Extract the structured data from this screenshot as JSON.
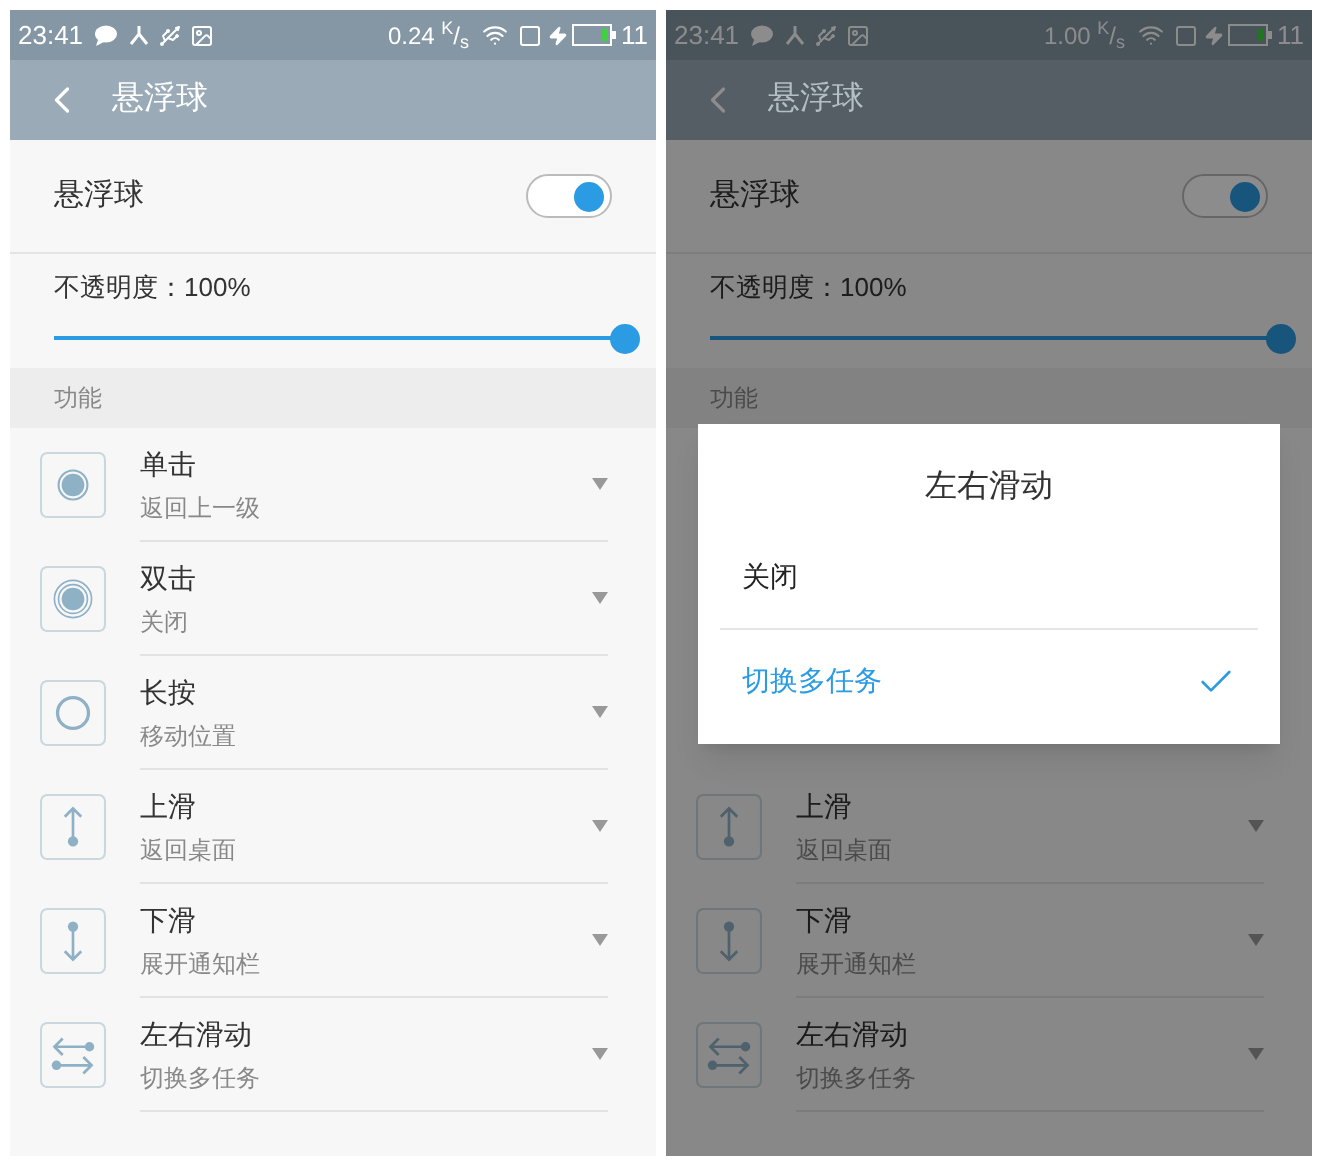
{
  "phones": [
    {
      "status_bar": {
        "time": "23:41",
        "speed": "0.24 $^{K}$/$_{s}$",
        "battery": "11"
      },
      "header": {
        "title": "悬浮球"
      },
      "toggle": {
        "label": "悬浮球",
        "on": true
      },
      "opacity": {
        "label": "不透明度：100%",
        "level": 1
      },
      "section": "功能",
      "items": [
        {
          "kind": "tap",
          "title": "单击",
          "subtitle": "返回上一级"
        },
        {
          "kind": "double-tap",
          "title": "双击",
          "subtitle": "关闭"
        },
        {
          "kind": "hold",
          "title": "长按",
          "subtitle": "移动位置"
        },
        {
          "kind": "swipe-up",
          "title": "上滑",
          "subtitle": "返回桌面"
        },
        {
          "kind": "swipe-down",
          "title": "下滑",
          "subtitle": "展开通知栏"
        },
        {
          "kind": "swipe-sideways",
          "title": "左右滑动",
          "subtitle": "切换多任务"
        }
      ]
    },
    {
      "status_bar": {
        "time": "23:41",
        "speed": "1.00 $^{K}$/$_{s}$",
        "battery": "11"
      },
      "header": {
        "title": "悬浮球"
      },
      "toggle": {
        "label": "悬浮球",
        "on": true
      },
      "opacity": {
        "label": "不透明度：100%",
        "level": 1
      },
      "section": "功能",
      "items": [
        {
          "kind": "swipe-up",
          "title": "上滑",
          "subtitle": "返回桌面"
        },
        {
          "kind": "swipe-down",
          "title": "下滑",
          "subtitle": "展开通知栏"
        },
        {
          "kind": "swipe-sideways",
          "title": "左右滑动",
          "subtitle": "切换多任务"
        }
      ],
      "dialog": {
        "title": "左右滑动",
        "options": [
          {
            "label": "关闭",
            "selected": false
          },
          {
            "label": "切换多任务",
            "selected": true
          }
        ]
      }
    }
  ]
}
